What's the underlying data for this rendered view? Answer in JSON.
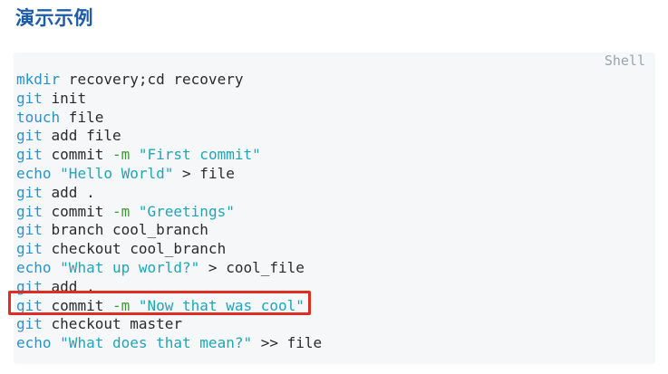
{
  "heading": "演示示例",
  "code_block": {
    "language": "Shell",
    "lines": [
      [
        {
          "t": "cmd",
          "v": "mkdir"
        },
        {
          "t": "plain",
          "v": " recovery;cd recovery"
        }
      ],
      [
        {
          "t": "cmd",
          "v": "git"
        },
        {
          "t": "plain",
          "v": " init"
        }
      ],
      [
        {
          "t": "cmd",
          "v": "touch"
        },
        {
          "t": "plain",
          "v": " file"
        }
      ],
      [
        {
          "t": "cmd",
          "v": "git"
        },
        {
          "t": "plain",
          "v": " add file"
        }
      ],
      [
        {
          "t": "cmd",
          "v": "git"
        },
        {
          "t": "plain",
          "v": " commit "
        },
        {
          "t": "flag",
          "v": "-m"
        },
        {
          "t": "plain",
          "v": " "
        },
        {
          "t": "str",
          "v": "\"First commit\""
        }
      ],
      [
        {
          "t": "cmd",
          "v": "echo"
        },
        {
          "t": "plain",
          "v": " "
        },
        {
          "t": "str",
          "v": "\"Hello World\""
        },
        {
          "t": "plain",
          "v": " > file"
        }
      ],
      [
        {
          "t": "cmd",
          "v": "git"
        },
        {
          "t": "plain",
          "v": " add ."
        }
      ],
      [
        {
          "t": "cmd",
          "v": "git"
        },
        {
          "t": "plain",
          "v": " commit "
        },
        {
          "t": "flag",
          "v": "-m"
        },
        {
          "t": "plain",
          "v": " "
        },
        {
          "t": "str",
          "v": "\"Greetings\""
        }
      ],
      [
        {
          "t": "cmd",
          "v": "git"
        },
        {
          "t": "plain",
          "v": " branch cool_branch"
        }
      ],
      [
        {
          "t": "cmd",
          "v": "git"
        },
        {
          "t": "plain",
          "v": " checkout cool_branch"
        }
      ],
      [
        {
          "t": "cmd",
          "v": "echo"
        },
        {
          "t": "plain",
          "v": " "
        },
        {
          "t": "str",
          "v": "\"What up world?\""
        },
        {
          "t": "plain",
          "v": " > cool_file"
        }
      ],
      [
        {
          "t": "cmd",
          "v": "git"
        },
        {
          "t": "plain",
          "v": " add ."
        }
      ],
      [
        {
          "t": "cmd",
          "v": "git"
        },
        {
          "t": "plain",
          "v": " commit "
        },
        {
          "t": "flag",
          "v": "-m"
        },
        {
          "t": "plain",
          "v": " "
        },
        {
          "t": "str",
          "v": "\"Now that was cool\""
        }
      ],
      [
        {
          "t": "cmd",
          "v": "git"
        },
        {
          "t": "plain",
          "v": " checkout master"
        }
      ],
      [
        {
          "t": "cmd",
          "v": "echo"
        },
        {
          "t": "plain",
          "v": " "
        },
        {
          "t": "str",
          "v": "\"What does that mean?\""
        },
        {
          "t": "plain",
          "v": " >> file"
        }
      ]
    ],
    "highlighted_line": 12
  },
  "colors": {
    "heading": "#1f5ca8",
    "command": "#2a93c8",
    "flag": "#3a9c2e",
    "string": "#1ea6b8",
    "highlight_border": "#e02d24",
    "code_background": "#f6f7f9"
  }
}
